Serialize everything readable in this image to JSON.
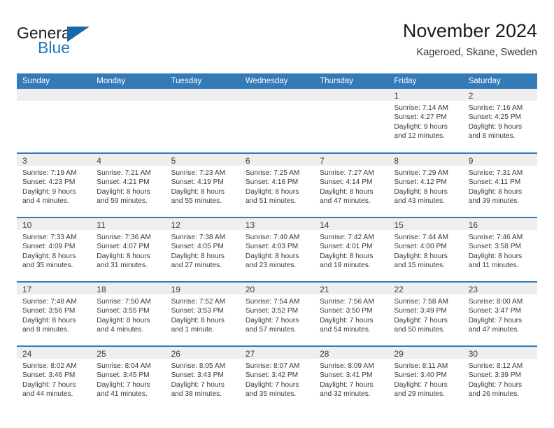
{
  "brand": {
    "name_top": "General",
    "name_bottom": "Blue",
    "color_primary": "#1f77c2",
    "color_triangle": "#1769aa"
  },
  "header": {
    "title": "November 2024",
    "subtitle": "Kageroed, Skane, Sweden"
  },
  "calendar": {
    "header_bg": "#337ab7",
    "daynum_bg": "#eeeeee",
    "weekdays": [
      "Sunday",
      "Monday",
      "Tuesday",
      "Wednesday",
      "Thursday",
      "Friday",
      "Saturday"
    ],
    "weeks": [
      [
        {
          "day": "",
          "lines": []
        },
        {
          "day": "",
          "lines": []
        },
        {
          "day": "",
          "lines": []
        },
        {
          "day": "",
          "lines": []
        },
        {
          "day": "",
          "lines": []
        },
        {
          "day": "1",
          "lines": [
            "Sunrise: 7:14 AM",
            "Sunset: 4:27 PM",
            "Daylight: 9 hours",
            "and 12 minutes."
          ]
        },
        {
          "day": "2",
          "lines": [
            "Sunrise: 7:16 AM",
            "Sunset: 4:25 PM",
            "Daylight: 9 hours",
            "and 8 minutes."
          ]
        }
      ],
      [
        {
          "day": "3",
          "lines": [
            "Sunrise: 7:19 AM",
            "Sunset: 4:23 PM",
            "Daylight: 9 hours",
            "and 4 minutes."
          ]
        },
        {
          "day": "4",
          "lines": [
            "Sunrise: 7:21 AM",
            "Sunset: 4:21 PM",
            "Daylight: 8 hours",
            "and 59 minutes."
          ]
        },
        {
          "day": "5",
          "lines": [
            "Sunrise: 7:23 AM",
            "Sunset: 4:19 PM",
            "Daylight: 8 hours",
            "and 55 minutes."
          ]
        },
        {
          "day": "6",
          "lines": [
            "Sunrise: 7:25 AM",
            "Sunset: 4:16 PM",
            "Daylight: 8 hours",
            "and 51 minutes."
          ]
        },
        {
          "day": "7",
          "lines": [
            "Sunrise: 7:27 AM",
            "Sunset: 4:14 PM",
            "Daylight: 8 hours",
            "and 47 minutes."
          ]
        },
        {
          "day": "8",
          "lines": [
            "Sunrise: 7:29 AM",
            "Sunset: 4:12 PM",
            "Daylight: 8 hours",
            "and 43 minutes."
          ]
        },
        {
          "day": "9",
          "lines": [
            "Sunrise: 7:31 AM",
            "Sunset: 4:11 PM",
            "Daylight: 8 hours",
            "and 39 minutes."
          ]
        }
      ],
      [
        {
          "day": "10",
          "lines": [
            "Sunrise: 7:33 AM",
            "Sunset: 4:09 PM",
            "Daylight: 8 hours",
            "and 35 minutes."
          ]
        },
        {
          "day": "11",
          "lines": [
            "Sunrise: 7:36 AM",
            "Sunset: 4:07 PM",
            "Daylight: 8 hours",
            "and 31 minutes."
          ]
        },
        {
          "day": "12",
          "lines": [
            "Sunrise: 7:38 AM",
            "Sunset: 4:05 PM",
            "Daylight: 8 hours",
            "and 27 minutes."
          ]
        },
        {
          "day": "13",
          "lines": [
            "Sunrise: 7:40 AM",
            "Sunset: 4:03 PM",
            "Daylight: 8 hours",
            "and 23 minutes."
          ]
        },
        {
          "day": "14",
          "lines": [
            "Sunrise: 7:42 AM",
            "Sunset: 4:01 PM",
            "Daylight: 8 hours",
            "and 19 minutes."
          ]
        },
        {
          "day": "15",
          "lines": [
            "Sunrise: 7:44 AM",
            "Sunset: 4:00 PM",
            "Daylight: 8 hours",
            "and 15 minutes."
          ]
        },
        {
          "day": "16",
          "lines": [
            "Sunrise: 7:46 AM",
            "Sunset: 3:58 PM",
            "Daylight: 8 hours",
            "and 11 minutes."
          ]
        }
      ],
      [
        {
          "day": "17",
          "lines": [
            "Sunrise: 7:48 AM",
            "Sunset: 3:56 PM",
            "Daylight: 8 hours",
            "and 8 minutes."
          ]
        },
        {
          "day": "18",
          "lines": [
            "Sunrise: 7:50 AM",
            "Sunset: 3:55 PM",
            "Daylight: 8 hours",
            "and 4 minutes."
          ]
        },
        {
          "day": "19",
          "lines": [
            "Sunrise: 7:52 AM",
            "Sunset: 3:53 PM",
            "Daylight: 8 hours",
            "and 1 minute."
          ]
        },
        {
          "day": "20",
          "lines": [
            "Sunrise: 7:54 AM",
            "Sunset: 3:52 PM",
            "Daylight: 7 hours",
            "and 57 minutes."
          ]
        },
        {
          "day": "21",
          "lines": [
            "Sunrise: 7:56 AM",
            "Sunset: 3:50 PM",
            "Daylight: 7 hours",
            "and 54 minutes."
          ]
        },
        {
          "day": "22",
          "lines": [
            "Sunrise: 7:58 AM",
            "Sunset: 3:49 PM",
            "Daylight: 7 hours",
            "and 50 minutes."
          ]
        },
        {
          "day": "23",
          "lines": [
            "Sunrise: 8:00 AM",
            "Sunset: 3:47 PM",
            "Daylight: 7 hours",
            "and 47 minutes."
          ]
        }
      ],
      [
        {
          "day": "24",
          "lines": [
            "Sunrise: 8:02 AM",
            "Sunset: 3:46 PM",
            "Daylight: 7 hours",
            "and 44 minutes."
          ]
        },
        {
          "day": "25",
          "lines": [
            "Sunrise: 8:04 AM",
            "Sunset: 3:45 PM",
            "Daylight: 7 hours",
            "and 41 minutes."
          ]
        },
        {
          "day": "26",
          "lines": [
            "Sunrise: 8:05 AM",
            "Sunset: 3:43 PM",
            "Daylight: 7 hours",
            "and 38 minutes."
          ]
        },
        {
          "day": "27",
          "lines": [
            "Sunrise: 8:07 AM",
            "Sunset: 3:42 PM",
            "Daylight: 7 hours",
            "and 35 minutes."
          ]
        },
        {
          "day": "28",
          "lines": [
            "Sunrise: 8:09 AM",
            "Sunset: 3:41 PM",
            "Daylight: 7 hours",
            "and 32 minutes."
          ]
        },
        {
          "day": "29",
          "lines": [
            "Sunrise: 8:11 AM",
            "Sunset: 3:40 PM",
            "Daylight: 7 hours",
            "and 29 minutes."
          ]
        },
        {
          "day": "30",
          "lines": [
            "Sunrise: 8:12 AM",
            "Sunset: 3:39 PM",
            "Daylight: 7 hours",
            "and 26 minutes."
          ]
        }
      ]
    ]
  }
}
